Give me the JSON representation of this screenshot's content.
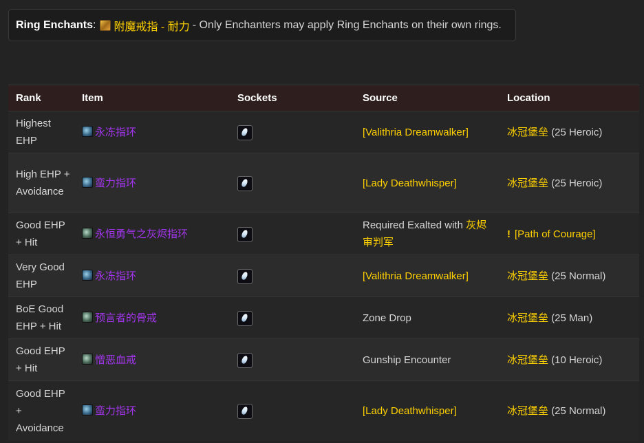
{
  "notice": {
    "label": "Ring Enchants",
    "colon": ":",
    "enchant_name": "附魔戒指 - 耐力",
    "description": "- Only Enchanters may apply Ring Enchants on their own rings."
  },
  "table": {
    "headers": {
      "rank": "Rank",
      "item": "Item",
      "sockets": "Sockets",
      "source": "Source",
      "location": "Location"
    },
    "rows": [
      {
        "rank": "Highest EHP",
        "item": "永冻指环",
        "source_prefix": "",
        "source_link": "[Valithria Dreamwalker]",
        "location_link": "冰冠堡垒",
        "location_suffix": "(25 Heroic)"
      },
      {
        "rank": "High EHP + Avoidance",
        "item": "蛮力指环",
        "source_prefix": "",
        "source_link": "[Lady Deathwhisper]",
        "location_link": "冰冠堡垒",
        "location_suffix": "(25 Heroic)"
      },
      {
        "rank": "Good EHP + Hit",
        "item": "永恒勇气之灰烬指环",
        "source_prefix": "Required Exalted with",
        "source_link": "灰烬审判军",
        "location_quest": "[Path of Courage]"
      },
      {
        "rank": "Very Good EHP",
        "item": "永冻指环",
        "source_prefix": "",
        "source_link": "[Valithria Dreamwalker]",
        "location_link": "冰冠堡垒",
        "location_suffix": "(25 Normal)"
      },
      {
        "rank": "BoE Good EHP + Hit",
        "item": "预言者的骨戒",
        "source_prefix": "Zone Drop",
        "source_link": "",
        "location_link": "冰冠堡垒",
        "location_suffix": "(25 Man)"
      },
      {
        "rank": "Good EHP + Hit",
        "item": "憎恶血戒",
        "source_prefix": "Gunship Encounter",
        "source_link": "",
        "location_link": "冰冠堡垒",
        "location_suffix": "(10 Heroic)"
      },
      {
        "rank": "Good EHP + Avoidance",
        "item": "蛮力指环",
        "source_prefix": "",
        "source_link": "[Lady Deathwhisper]",
        "location_link": "冰冠堡垒",
        "location_suffix": "(25 Normal)"
      }
    ]
  },
  "colors": {
    "epic_item": "#a335ee",
    "gold_link": "#ffd100",
    "header_bg": "#2e1e1e"
  }
}
